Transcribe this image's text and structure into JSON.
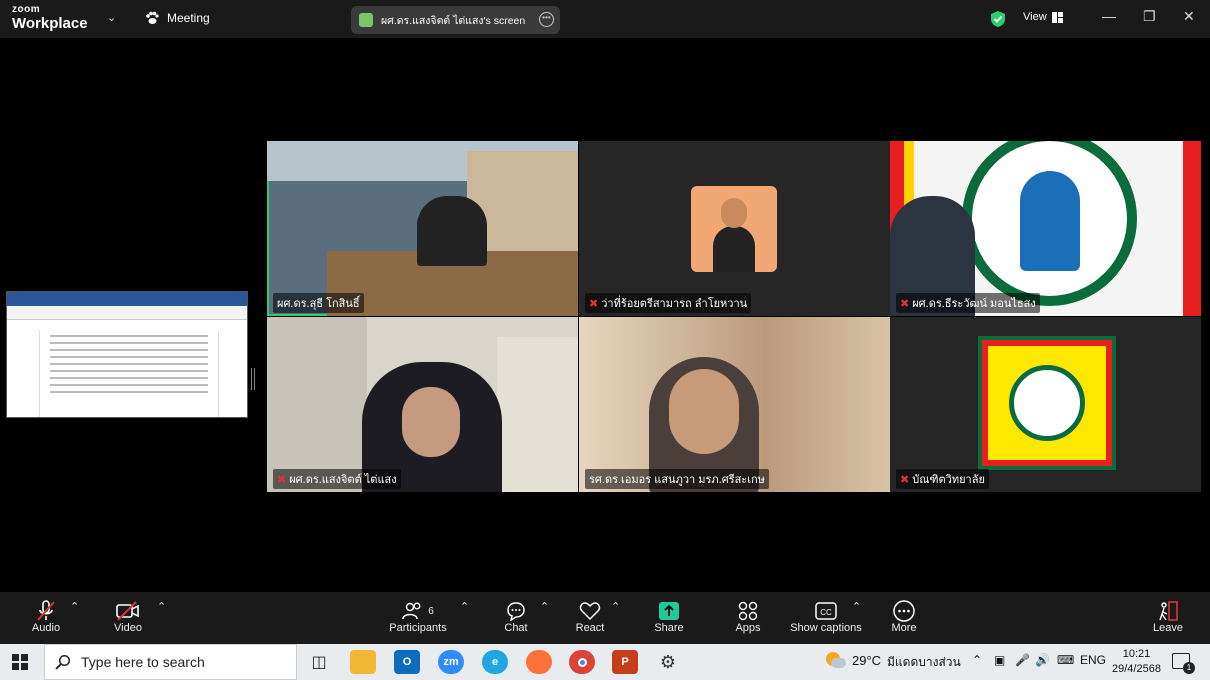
{
  "app": {
    "logo_top": "zoom",
    "logo_bottom": "Workplace",
    "meeting_label": "Meeting",
    "view_label": "View"
  },
  "screen_share": {
    "label": "ผศ.ดร.แสงจิตต์ ไต่แสง's screen"
  },
  "participants_tiles": [
    {
      "name": "ผศ.ดร.สุธี โกสินธิ์",
      "muted": false,
      "active": true
    },
    {
      "name": "ว่าที่ร้อยตรีสามารถ ลำโยหวาน",
      "muted": true,
      "active": false
    },
    {
      "name": "ผศ.ดร.ธีระวัฒน์ มอนไธสง",
      "muted": true,
      "active": false
    },
    {
      "name": "ผศ.ดร.แสงจิตต์ ไต่แสง",
      "muted": true,
      "active": false
    },
    {
      "name": "รศ.ดร.เอมอร แสนภูวา มรภ.ศรีสะเกษ",
      "muted": false,
      "active": false
    },
    {
      "name": "บัณฑิตวิทยาลัย",
      "muted": true,
      "active": false
    }
  ],
  "toolbar": {
    "audio": "Audio",
    "video": "Video",
    "participants": "Participants",
    "participants_count": "6",
    "chat": "Chat",
    "react": "React",
    "share": "Share",
    "apps": "Apps",
    "captions": "Show captions",
    "more": "More",
    "leave": "Leave"
  },
  "taskbar": {
    "search_placeholder": "Type here to search",
    "weather_temp": "29°C",
    "weather_text": "มีแดดบางส่วน",
    "lang": "ENG",
    "time": "10:21",
    "date": "29/4/2568",
    "notif_count": "1"
  },
  "colors": {
    "accent_green": "#2ecc71",
    "mute_red": "#e0303a",
    "share_green": "#20c997"
  }
}
